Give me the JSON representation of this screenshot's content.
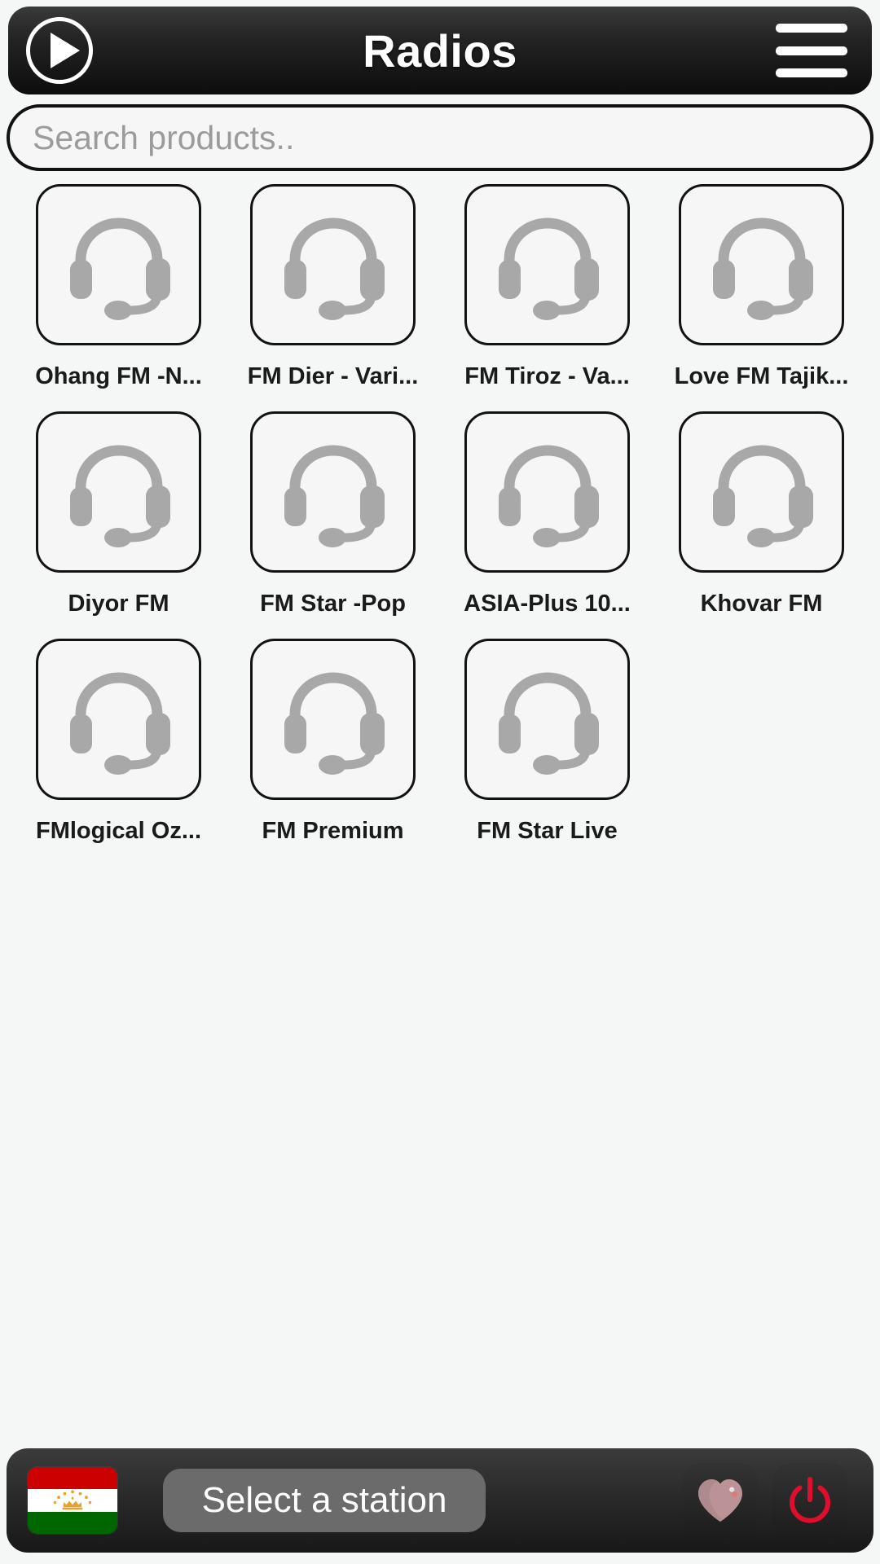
{
  "header": {
    "title": "Radios",
    "play_icon": "play-icon",
    "menu_icon": "hamburger-menu-icon"
  },
  "search": {
    "placeholder": "Search products..",
    "value": ""
  },
  "grid": {
    "item_icon": "headset-icon",
    "items": [
      {
        "label": "Ohang FM -N..."
      },
      {
        "label": "FM Dier - Vari..."
      },
      {
        "label": "FM Tiroz - Va..."
      },
      {
        "label": "Love FM Tajik..."
      },
      {
        "label": "Diyor FM"
      },
      {
        "label": "FM Star -Pop"
      },
      {
        "label": "ASIA-Plus 10..."
      },
      {
        "label": "Khovar FM"
      },
      {
        "label": "FMlogical Oz..."
      },
      {
        "label": "FM Premium"
      },
      {
        "label": "FM Star Live"
      }
    ]
  },
  "bottom_bar": {
    "flag_name": "tajikistan-flag",
    "station_label": "Select a station",
    "favorite_icon": "heart-icon",
    "power_icon": "power-icon"
  },
  "colors": {
    "background": "#f5f6f6",
    "bar_dark": "#232323",
    "tile_border": "#121212",
    "tile_fill": "#f6f6f6",
    "headset_gray": "#a8a8a8",
    "placeholder_gray": "#9b9b9b",
    "select_gray": "#6b6b6b",
    "heart_rose": "#bb9296",
    "power_red": "#e00e2d",
    "flag_red": "#cc0000",
    "flag_green": "#006600",
    "flag_gold": "#f8c93c"
  }
}
